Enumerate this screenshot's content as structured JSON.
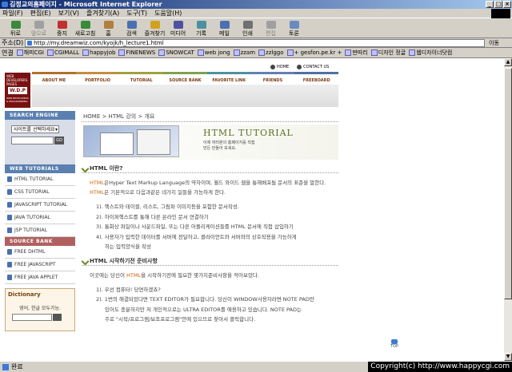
{
  "window": {
    "title": "김정교의홈페이지 - Microsoft Internet Explorer"
  },
  "menu": [
    "파일(F)",
    "편집(E)",
    "보기(V)",
    "즐겨찾기(A)",
    "도구(T)",
    "도움말(H)"
  ],
  "toolbar": [
    {
      "label": "뒤로",
      "icon": "back-arrow-icon",
      "enabled": true,
      "color": "#3a8a3a"
    },
    {
      "label": "앞으로",
      "icon": "forward-arrow-icon",
      "enabled": false,
      "color": "#a0a0a0"
    },
    {
      "label": "중지",
      "icon": "stop-icon",
      "enabled": true,
      "color": "#c03030"
    },
    {
      "label": "새로고침",
      "icon": "refresh-icon",
      "enabled": true,
      "color": "#3a8a3a"
    },
    {
      "label": "홈",
      "icon": "home-icon",
      "enabled": true,
      "color": "#b08040"
    },
    {
      "label": "검색",
      "icon": "search-icon",
      "enabled": true,
      "color": "#4a70b0"
    },
    {
      "label": "즐겨찾기",
      "icon": "favorites-icon",
      "enabled": true,
      "color": "#d0a020"
    },
    {
      "label": "미디어",
      "icon": "media-icon",
      "enabled": true,
      "color": "#5050a0"
    },
    {
      "label": "기록",
      "icon": "history-icon",
      "enabled": true,
      "color": "#4a90a0"
    },
    {
      "label": "메일",
      "icon": "mail-icon",
      "enabled": true,
      "color": "#4a70b0"
    },
    {
      "label": "인쇄",
      "icon": "print-icon",
      "enabled": true,
      "color": "#707070"
    },
    {
      "label": "편집",
      "icon": "edit-icon",
      "enabled": false,
      "color": "#a0a0a0"
    },
    {
      "label": "토론",
      "icon": "discuss-icon",
      "enabled": true,
      "color": "#6a8ac0"
    }
  ],
  "address": {
    "label": "주소(D)",
    "url": "http://my.dreamwiz.com/kyojk/h_lecture1.html",
    "go": "이동"
  },
  "links": {
    "label": "연결",
    "items": [
      "해피CGI",
      "CGIMALL",
      "happyjob",
      "FINENEWS",
      "SNOWCAT",
      "web jong",
      "zzam",
      "zzlggo",
      "+ gesfon.pe.kr +",
      "딴따리",
      "디자인 정글",
      "웹디자이너닷컴"
    ]
  },
  "site": {
    "logo_top": "WEB DEVELOPERS PAGES",
    "logo_main": "W.D.P",
    "logo_sub": "WEB DEVELOPERS & PROGRAMMING",
    "top_links": [
      "HOME",
      "CONTACT US"
    ],
    "nav": [
      "ABOUT ME",
      "PORTFOLIO",
      "TUTORIAL",
      "SOURCE BANK",
      "FAVORITE LINK",
      "FRIENDS",
      "FREEBOARD"
    ]
  },
  "sidebar": {
    "search_header": "SEARCH ENGINE",
    "search_select": "사이트를 선택하세요",
    "search_button": "GO",
    "tutorials_header": "WEB TUTORIALS",
    "tutorials": [
      "HTML TUTORIAL",
      "CSS TUTORIAL",
      "JAVASCRIPT TUTORIAL",
      "JAVA TUTORIAL",
      "JSP TUTORIAL"
    ],
    "source_header": "SOURCE BANK",
    "sources": [
      "FREE DHTML",
      "FREE JAVASCRIPT",
      "FREE JAVA APPLET"
    ],
    "dict_title": "Dictionary",
    "dict_desc": "영어, 한글 모두가능.",
    "dict_button": "GO"
  },
  "main": {
    "breadcrumb": "HOME > HTML 강의 > 개요",
    "hero_title": "HTML TUTORIAL",
    "hero_sub1": "이제 여러분의 홈페이지를 직접",
    "hero_sub2": "만든 만들어 보세요.",
    "sec1_title": "HTML 이란?",
    "sec1_para": {
      "p1": "HTML",
      "p2": "은Hyper Text Markup Language의 약자이며, 월드 와이드 웹을 통해배포될 문서의 표준을 말한다. ",
      "p3": "HTML",
      "p4": "은 기본적으로 다음과같은 네가지 일들을 가능하게 한다."
    },
    "sec1_items": [
      "1). 헥스트와 테이블, 리스트, 그림파 이미지등을 포함한 문서작성.",
      "2). 하이퍼헥스트를 통해 다른 온라인 문서 연결하기",
      "3). 통화상 파일이나 사운드파일, 또는 다른 어플리케이션들를 HTML 문서에 직접 삽입하기",
      "4). 사용자가 입력한 데이터를 서버에 전달하고, 클라이언트와 서버와의 상호작용을 가능하게",
      "하는 입력양식을 작성"
    ],
    "sec2_title": "HTML 시작하기전 준비사항",
    "sec2_para": {
      "p1": "이곳에는 당신이 ",
      "p2": "HTML",
      "p3": "을 시작하기전에 필요한 몇가지준비사항을 적어보았다."
    },
    "sec2_items": [
      "1). 우선 컴퓨터! 당연하겠죠?",
      "2). 1번의 해결되었다면 TEXT EDITOR가 필요합니다. 당신이 WINDOW사용자라면 NOTE PAD만",
      "있어도 충분하지만 저 개인적으로는 ULTRA EDITOR를 애용하고 있습니다.  NOTE PAD는",
      "주로 \"시작/프로그램/보조프로그램\"안에 있으므로 찾아서 클릭합니다."
    ],
    "top_label": "TOP"
  },
  "status": {
    "text": "완료",
    "copyright": "Copyright(c) http://www.happycgi.com"
  }
}
